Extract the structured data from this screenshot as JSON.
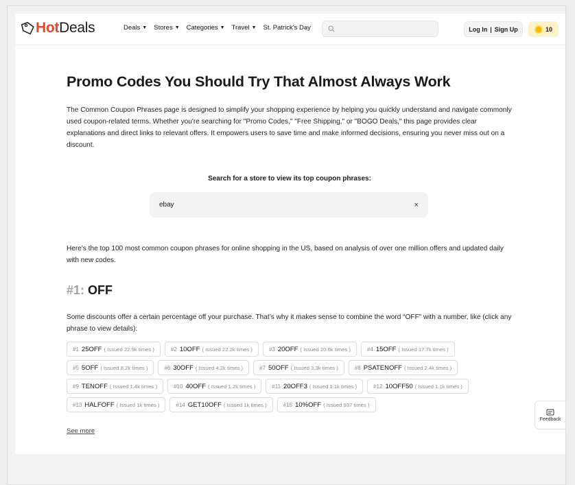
{
  "brand": {
    "logo_hot": "Hot",
    "logo_deals": "Deals",
    "accent": "#e8452c"
  },
  "nav": {
    "menu": [
      {
        "label": "Deals",
        "caret": "▼"
      },
      {
        "label": "Stores",
        "caret": "▼"
      },
      {
        "label": "Categories",
        "caret": "▼"
      },
      {
        "label": "Travel",
        "caret": "▼"
      },
      {
        "label": "St. Patrick's Day",
        "caret": ""
      }
    ],
    "search_placeholder": "",
    "login_label": "Log In",
    "separator": "|",
    "signup_label": "Sign Up",
    "coins": "10"
  },
  "main": {
    "title": "Promo Codes You Should Try That Almost Always Work",
    "intro": "The Common Coupon Phrases page is designed to simplify your shopping experience by helping you quickly understand and navigate commonly used coupon-related terms. Whether you're searching for \"Promo Codes,\" \"Free Shipping,\" or \"BOGO Deals,\" this page provides clear explanations and direct links to relevant offers. It empowers users to save time and make informed decisions, ensuring you never miss out on a discount.",
    "search_title": "Search for a store to view its top coupon phrases:",
    "search_value": "ebay",
    "clear_icon": "×",
    "top100_text": "Here's the top 100 most common coupon phrases for online shopping in the US, based on analysis of over one million offers and updated daily with new codes.",
    "rank_number": "#1:",
    "rank_word": "OFF",
    "rank_desc": "Some discounts offer a certain percentage off your purchase. That’s why it makes sense to combine the word “OFF” with a number, like (click any phrase to view details):",
    "see_more": "See more"
  },
  "chips": [
    [
      {
        "n": "#1",
        "code": "25OFF",
        "issued": "( Issued 22.9k times )"
      },
      {
        "n": "#2",
        "code": "10OFF",
        "issued": "( Issued 22.2k times )"
      },
      {
        "n": "#3",
        "code": "20OFF",
        "issued": "( Issued 20.8k times )"
      },
      {
        "n": "#4",
        "code": "15OFF",
        "issued": "( Issued 17.7k times )"
      }
    ],
    [
      {
        "n": "#5",
        "code": "5OFF",
        "issued": "( Issued 8.2k times )"
      },
      {
        "n": "#6",
        "code": "30OFF",
        "issued": "( Issued 4.2k times )"
      },
      {
        "n": "#7",
        "code": "50OFF",
        "issued": "( Issued 3.3k times )"
      },
      {
        "n": "#8",
        "code": "PSATENOFF",
        "issued": "( Issued 2.4k times )"
      }
    ],
    [
      {
        "n": "#9",
        "code": "TENOFF",
        "issued": "( Issued 1.4k times )"
      },
      {
        "n": "#10",
        "code": "40OFF",
        "issued": "( Issued 1.2k times )"
      },
      {
        "n": "#11",
        "code": "20OFF3",
        "issued": "( Issued 1.1k times )"
      },
      {
        "n": "#12",
        "code": "10OFF50",
        "issued": "( Issued 1.1k times )"
      }
    ],
    [
      {
        "n": "#13",
        "code": "HALFOFF",
        "issued": "( Issued 1k times )"
      },
      {
        "n": "#14",
        "code": "GET10OFF",
        "issued": "( Issued 1k times )"
      },
      {
        "n": "#15",
        "code": "10%OFF",
        "issued": "( Issued 937 times )"
      }
    ]
  ],
  "feedback": {
    "label": "Feedback"
  }
}
